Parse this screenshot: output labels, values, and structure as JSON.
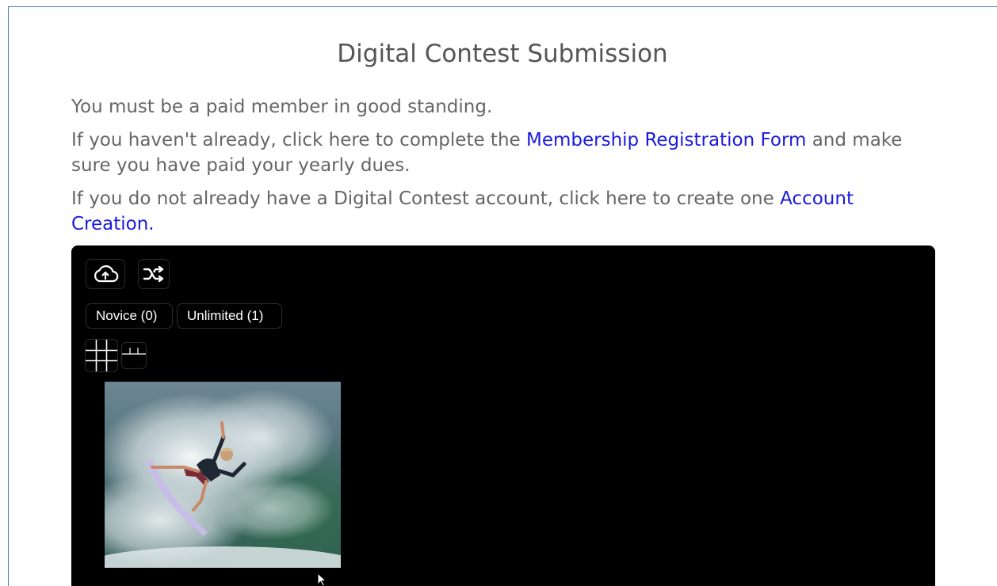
{
  "page": {
    "title": "Digital Contest Submission",
    "line1": "You must be a paid member in good standing.",
    "line2_before": "If you haven't already, click here to complete the ",
    "line2_link": "Membership Registration Form",
    "line2_after": " and make sure you have paid your yearly dues.",
    "line3_before": "If you do not already have a Digital Contest account, click here to create one ",
    "line3_link": "Account Creation."
  },
  "colors": {
    "link": "#1a1adc",
    "text": "#666666",
    "panel_background": "#000000",
    "frame_border": "#4a78b8"
  },
  "toolbar": {
    "upload_icon": "cloud-upload-icon",
    "shuffle_icon": "shuffle-icon"
  },
  "categories": [
    {
      "label": "Novice (0)"
    },
    {
      "label": "Unlimited (1)"
    }
  ],
  "view_modes": {
    "grid_icon": "grid-view-icon",
    "single_icon": "single-view-icon"
  },
  "gallery": {
    "thumbnails": [
      {
        "subject": "surfer-photo"
      }
    ]
  }
}
